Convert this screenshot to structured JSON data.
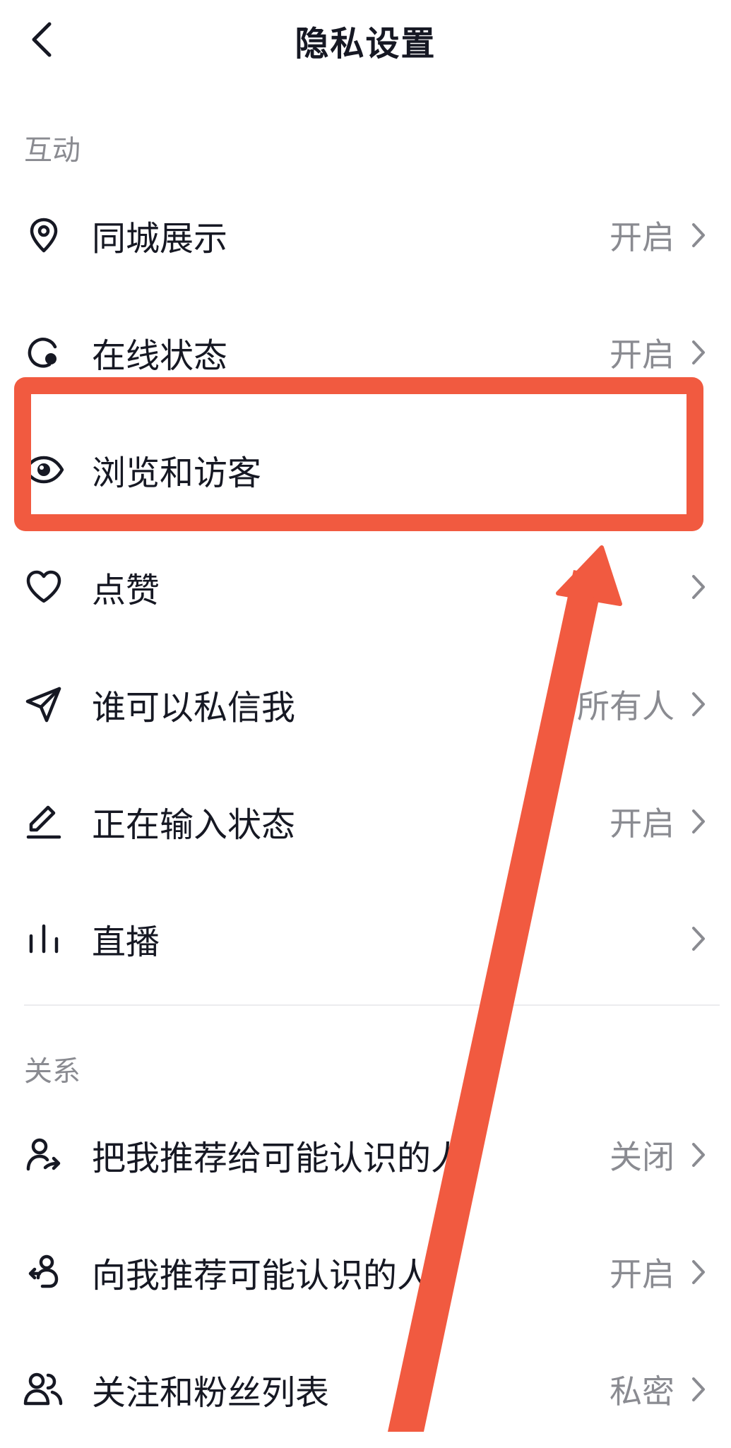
{
  "header": {
    "title": "隐私设置",
    "back_icon": "chevron-left-icon"
  },
  "sections": [
    {
      "title": "互动",
      "items": [
        {
          "icon": "location-pin-icon",
          "label": "同城展示",
          "value": "开启"
        },
        {
          "icon": "online-status-icon",
          "label": "在线状态",
          "value": "开启"
        },
        {
          "icon": "eye-icon",
          "label": "浏览和访客",
          "value": ""
        },
        {
          "icon": "heart-icon",
          "label": "点赞",
          "value": ""
        },
        {
          "icon": "send-icon",
          "label": "谁可以私信我",
          "value": "所有人"
        },
        {
          "icon": "pen-icon",
          "label": "正在输入状态",
          "value": "开启"
        },
        {
          "icon": "live-bars-icon",
          "label": "直播",
          "value": ""
        }
      ]
    },
    {
      "title": "关系",
      "items": [
        {
          "icon": "user-share-icon",
          "label": "把我推荐给可能认识的人",
          "value": "关闭"
        },
        {
          "icon": "user-recommend-icon",
          "label": "向我推荐可能认识的人",
          "value": "开启"
        },
        {
          "icon": "users-icon",
          "label": "关注和粉丝列表",
          "value": "私密"
        }
      ]
    }
  ],
  "annotation": {
    "highlight_color": "#f15a40",
    "highlighted_item": "浏览和访客"
  },
  "colors": {
    "text_primary": "#161823",
    "text_secondary": "#8a8b91",
    "divider": "#ececee"
  }
}
